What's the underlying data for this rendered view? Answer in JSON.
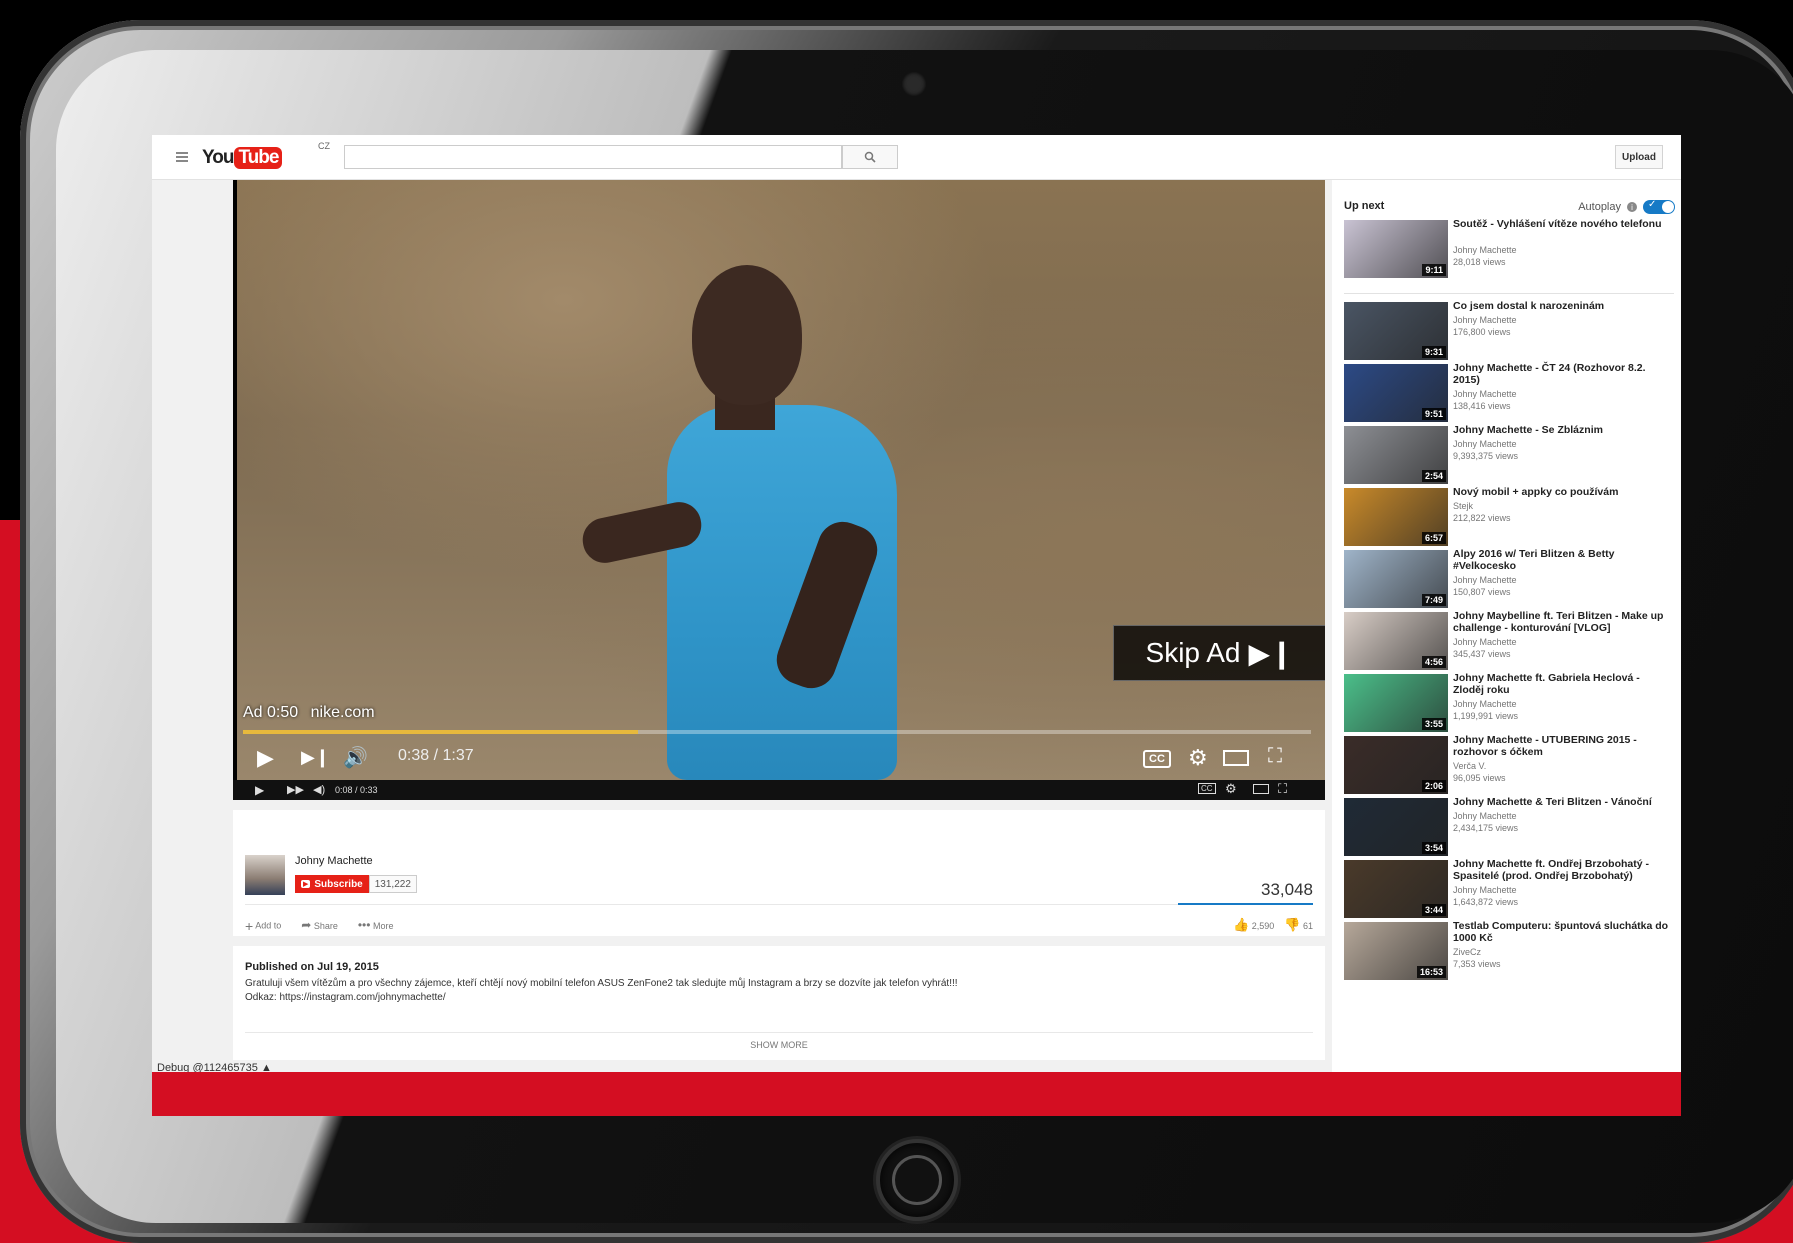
{
  "header": {
    "logo_you": "You",
    "logo_tube": "Tube",
    "logo_country": "CZ",
    "search_placeholder": "",
    "upload_label": "Upload"
  },
  "player": {
    "ad_time": "Ad 0:50",
    "ad_domain": "nike.com",
    "skip_ad": "Skip Ad",
    "time": "0:38 / 1:37",
    "progress": 0.37,
    "mini_time": "0:08 / 0:33"
  },
  "channel": {
    "name": "Johny Machette",
    "subscribe_label": "Subscribe",
    "subscriber_count": "131,222",
    "view_count": "33,048",
    "add_to": "Add to",
    "share": "Share",
    "more": "More",
    "likes": "2,590",
    "dislikes": "61"
  },
  "description": {
    "published": "Published on Jul 19, 2015",
    "line1": "Gratuluji všem vítězům a pro všechny zájemce, kteří chtějí nový mobilní telefon ASUS ZenFone2 tak sledujte můj Instagram a brzy se dozvíte jak telefon vyhrát!!!",
    "line2": "Odkaz: https://instagram.com/johnymachette/",
    "show_more": "SHOW MORE"
  },
  "debug": "Debug @112465735",
  "sidebar": {
    "up_next": "Up next",
    "autoplay": "Autoplay",
    "videos": [
      {
        "title": "Soutěž - Vyhlášení vítěze nového telefonu",
        "channel": "Johny Machette",
        "views": "28,018 views",
        "duration": "9:11",
        "color": "#c9c3d3"
      },
      {
        "title": "Co jsem dostal k narozeninám",
        "channel": "Johny Machette",
        "views": "176,800 views",
        "duration": "9:31",
        "color": "#4a5564"
      },
      {
        "title": "Johny Machette - ČT 24 (Rozhovor 8.2. 2015)",
        "channel": "Johny Machette",
        "views": "138,416 views",
        "duration": "9:51",
        "color": "#2c4a86"
      },
      {
        "title": "Johny Machette - Se Zbláznim",
        "channel": "Johny Machette",
        "views": "9,393,375 views",
        "duration": "2:54",
        "color": "#8d8f94"
      },
      {
        "title": "Nový mobil + appky co používám",
        "channel": "Stejk",
        "views": "212,822 views",
        "duration": "6:57",
        "color": "#c98a2a"
      },
      {
        "title": "Alpy 2016 w/ Teri Blitzen & Betty #Velkocesko",
        "channel": "Johny Machette",
        "views": "150,807 views",
        "duration": "7:49",
        "color": "#9fb4c9"
      },
      {
        "title": "Johny Maybelline ft. Teri Blitzen - Make up challenge - konturování [VLOG]",
        "channel": "Johny Machette",
        "views": "345,437 views",
        "duration": "4:56",
        "color": "#d8cdc6"
      },
      {
        "title": "Johny Machette ft. Gabriela Heclová - Zloděj roku",
        "channel": "Johny Machette",
        "views": "1,199,991 views",
        "duration": "3:55",
        "color": "#4bbf8a"
      },
      {
        "title": "Johny Machette - UTUBERING 2015 - rozhovor s óčkem",
        "channel": "Verča V.",
        "views": "96,095 views",
        "duration": "2:06",
        "color": "#3a2c28"
      },
      {
        "title": "Johny Machette & Teri Blitzen - Vánoční",
        "channel": "Johny Machette",
        "views": "2,434,175 views",
        "duration": "3:54",
        "color": "#1f2a36"
      },
      {
        "title": "Johny Machette ft. Ondřej Brzobohatý - Spasitelé (prod. Ondřej Brzobohatý)",
        "channel": "Johny Machette",
        "views": "1,643,872 views",
        "duration": "3:44",
        "color": "#4a3a2a"
      },
      {
        "title": "Testlab Computeru: špuntová sluchátka do 1000 Kč",
        "channel": "ZiveCz",
        "views": "7,353 views",
        "duration": "16:53",
        "color": "#b6a89a"
      }
    ]
  }
}
